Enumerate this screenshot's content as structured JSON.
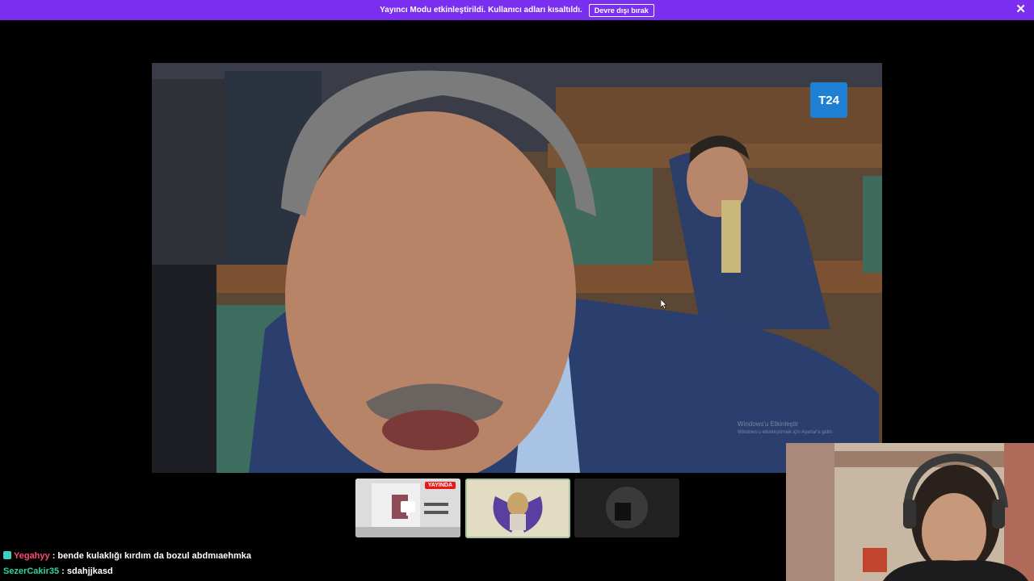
{
  "banner": {
    "message": "Yayıncı Modu etkinleştirildi. Kullanıcı adları kısaltıldı.",
    "disable_label": "Devre dışı bırak",
    "close_glyph": "✕",
    "bg_color": "#7a2ff0"
  },
  "video": {
    "channel_logo": "T24",
    "windows_watermark": "Windows'u Etkinleştir",
    "windows_watermark_sub": "Windows'u etkinleştirmek için Ayarlar'a gidin."
  },
  "thumbnails": [
    {
      "name": "screen-share",
      "badge": "YAYINDA",
      "icon": "monitor-icon"
    },
    {
      "name": "avatar-winged-lion",
      "icon": "avatar"
    },
    {
      "name": "avatar-dark",
      "icon": "avatar"
    }
  ],
  "chat": {
    "messages": [
      {
        "user": "Yegahyy",
        "separator": " : ",
        "text": "bende kulaklığı kırdım da bozul abdmıaehmka",
        "user_color": "#ff4a75",
        "badge_icon": "subscriber-badge-icon"
      },
      {
        "user": "SezerCakir35",
        "separator": " : ",
        "text": "sdahjjkasd",
        "user_color": "#2fd69b"
      }
    ]
  }
}
